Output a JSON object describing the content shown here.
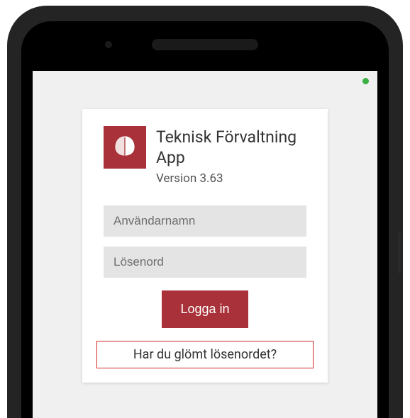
{
  "app": {
    "title": "Teknisk Förvaltning App",
    "version": "Version 3.63"
  },
  "form": {
    "username_placeholder": "Användarnamn",
    "password_placeholder": "Lösenord",
    "login_label": "Logga in",
    "forgot_label": "Har du glömt lösenordet?"
  },
  "colors": {
    "brand": "#a93139",
    "highlight_border": "#d22828"
  }
}
